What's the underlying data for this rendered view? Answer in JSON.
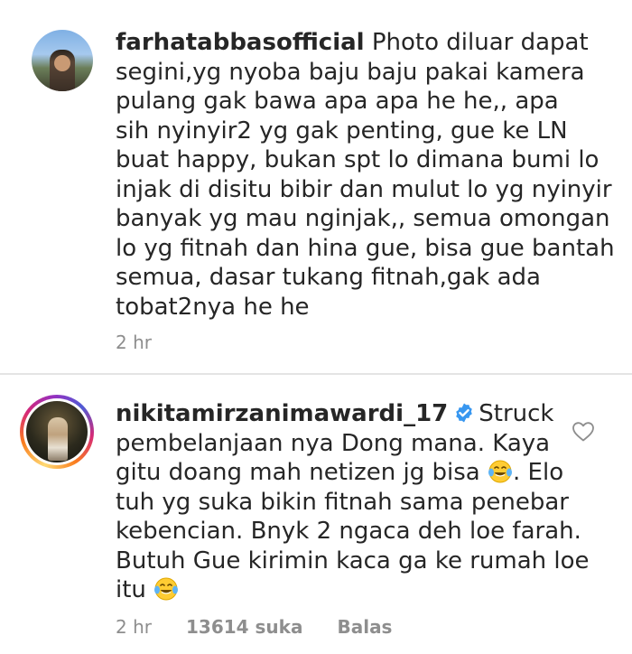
{
  "comments": [
    {
      "username": "farhatabbasofficial",
      "lines": [
        "Photo diluar dapat",
        "segini,yg nyoba baju baju pakai kamera",
        "pulang gak bawa apa apa he he,, apa",
        "sih nyinyir2 yg gak penting, gue ke LN",
        "buat happy, bukan spt lo dimana bumi lo",
        "injak di disitu bibir dan mulut lo yg nyinyir",
        "banyak yg mau nginjak,, semua omongan",
        "lo yg fitnah dan hina gue, bisa gue bantah",
        "semua, dasar tukang fitnah,gak ada",
        "tobat2nya he he"
      ],
      "time": "2 hr"
    },
    {
      "username": "nikitamirzanimawardi_17",
      "verified": true,
      "lines": [
        "Struck",
        "pembelanjaan nya Dong mana. Kaya",
        "gitu doang mah netizen jg bisa",
        ". Elo",
        "tuh yg suka bikin fitnah sama penebar",
        "kebencian. Bnyk 2 ngaca deh loe farah.",
        "Butuh Gue kirimin kaca ga ke rumah loe",
        "itu"
      ],
      "time": "2 hr",
      "likes": "13614 suka",
      "reply_label": "Balas",
      "emoji": "face-with-tears-of-joy"
    }
  ],
  "colors": {
    "text": "#262626",
    "meta": "#8e8e8e",
    "verified": "#3897f0",
    "divider": "#e4e4e4"
  },
  "icons": {
    "verified": "verified-badge-icon",
    "heart": "heart-outline-icon"
  }
}
